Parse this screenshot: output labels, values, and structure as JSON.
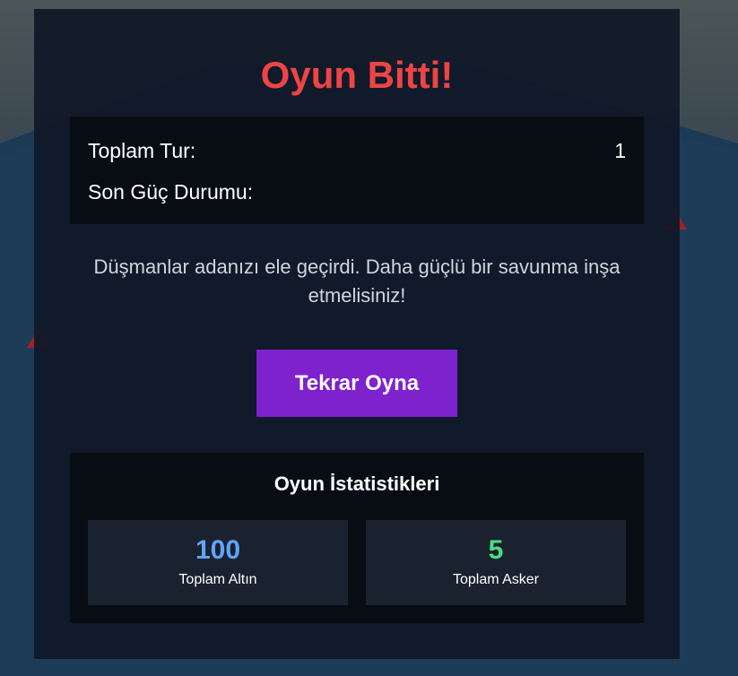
{
  "game_over": {
    "title": "Oyun Bitti!",
    "summary": [
      {
        "label": "Toplam Tur:",
        "value": "1"
      },
      {
        "label": "Son Güç Durumu:",
        "value": ""
      }
    ],
    "message": "Düşmanlar adanızı ele geçirdi. Daha güçlü bir savunma inşa etmelisiniz!",
    "replay_label": "Tekrar Oyna"
  },
  "stats": {
    "title": "Oyun İstatistikleri",
    "gold": {
      "value": "100",
      "label": "Toplam Altın"
    },
    "soldiers": {
      "value": "5",
      "label": "Toplam Asker"
    }
  },
  "background": {
    "warning_icons": [
      "warning-icon",
      "warning-icon"
    ]
  },
  "colors": {
    "title": "#ef4444",
    "accent_button": "#7e22ce",
    "gold_value": "#60a5fa",
    "soldier_value": "#4ade80"
  }
}
